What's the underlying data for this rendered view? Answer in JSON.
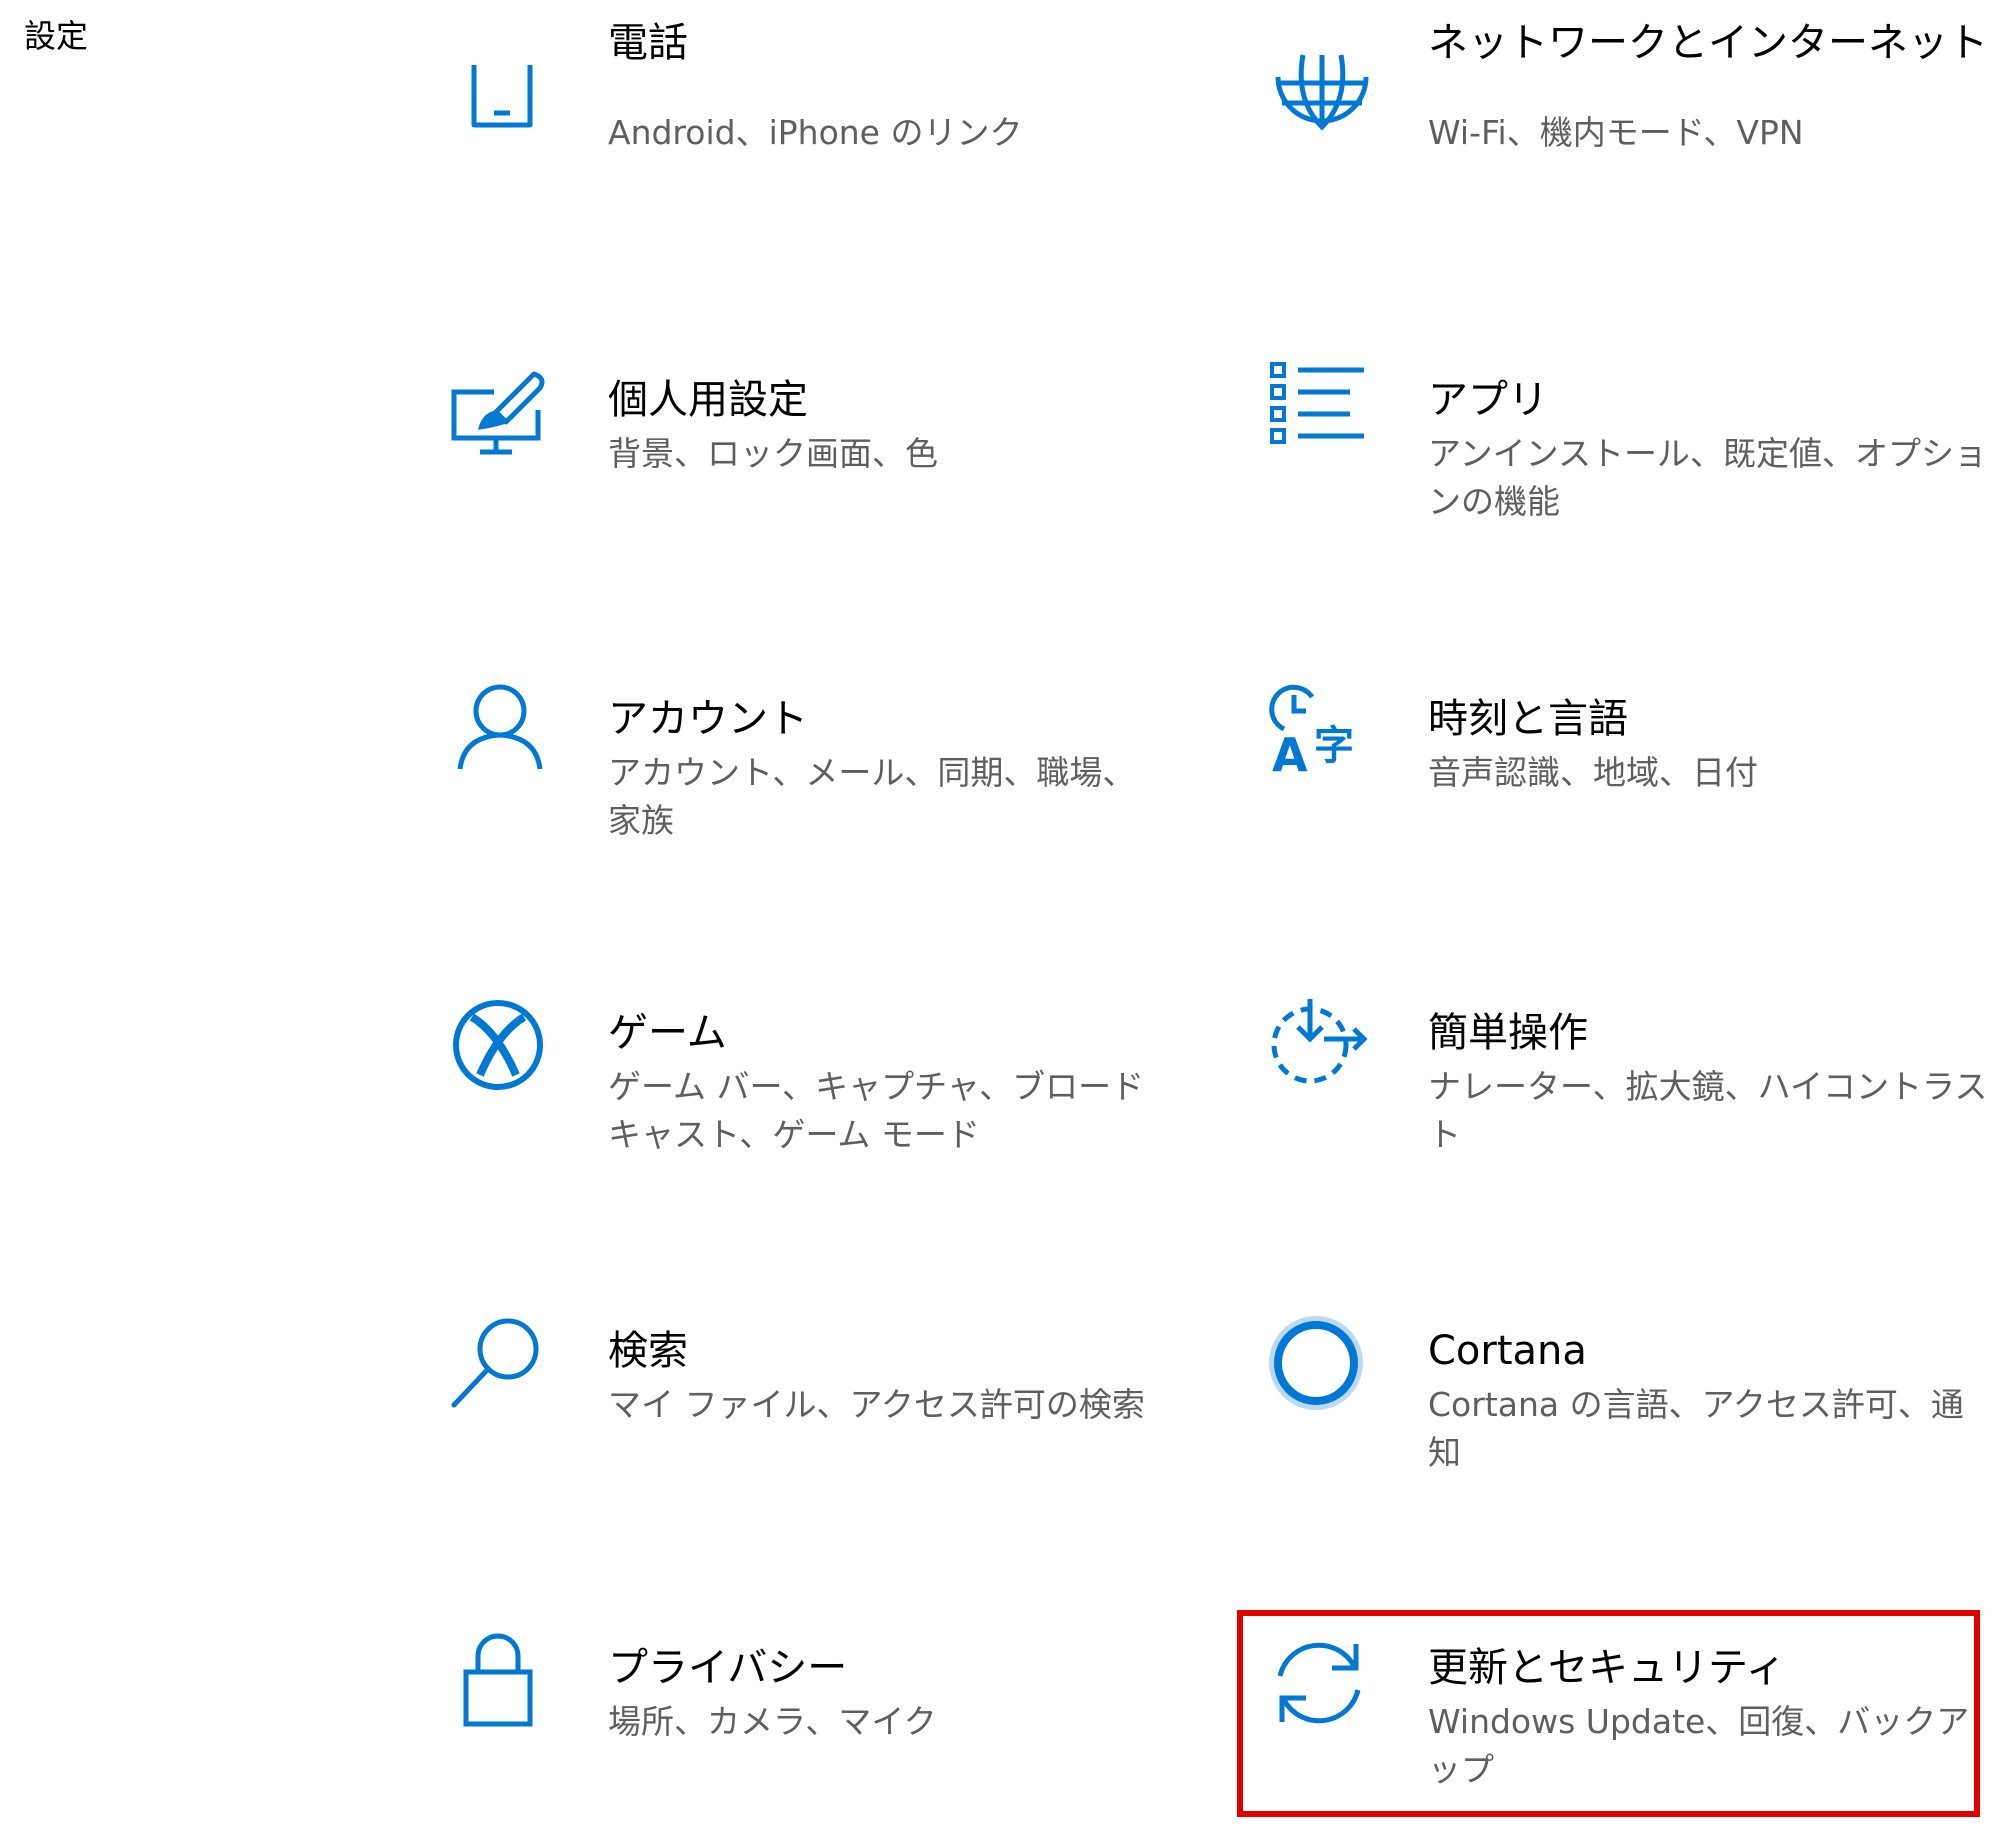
{
  "window": {
    "title": "設定"
  },
  "tiles": [
    {
      "key": "phone",
      "icon": "phone-icon",
      "title": "電話",
      "desc": "Android、iPhone のリンク"
    },
    {
      "key": "network",
      "icon": "globe-icon",
      "title": "ネットワークとインターネット",
      "desc": "Wi-Fi、機内モード、VPN"
    },
    {
      "key": "personalization",
      "icon": "personalization-icon",
      "title": "個人用設定",
      "desc": "背景、ロック画面、色"
    },
    {
      "key": "apps",
      "icon": "apps-list-icon",
      "title": "アプリ",
      "desc": "アンインストール、既定値、オプションの機能"
    },
    {
      "key": "accounts",
      "icon": "person-icon",
      "title": "アカウント",
      "desc": "アカウント、メール、同期、職場、家族"
    },
    {
      "key": "time-language",
      "icon": "time-language-icon",
      "title": "時刻と言語",
      "desc": "音声認識、地域、日付"
    },
    {
      "key": "gaming",
      "icon": "xbox-icon",
      "title": "ゲーム",
      "desc": "ゲーム バー、キャプチャ、ブロードキャスト、ゲーム モード"
    },
    {
      "key": "ease-of-access",
      "icon": "ease-of-access-icon",
      "title": "簡単操作",
      "desc": "ナレーター、拡大鏡、ハイコントラスト"
    },
    {
      "key": "search",
      "icon": "search-icon",
      "title": "検索",
      "desc": "マイ ファイル、アクセス許可の検索"
    },
    {
      "key": "cortana",
      "icon": "cortana-icon",
      "title": "Cortana",
      "desc": "Cortana の言語、アクセス許可、通知"
    },
    {
      "key": "privacy",
      "icon": "lock-icon",
      "title": "プライバシー",
      "desc": "場所、カメラ、マイク"
    },
    {
      "key": "update-security",
      "icon": "sync-icon",
      "title": "更新とセキュリティ",
      "desc": "Windows Update、回復、バックアップ"
    }
  ],
  "colors": {
    "accent": "#0078d4",
    "description_text": "#5f5f5f",
    "highlight": "#e00000"
  }
}
